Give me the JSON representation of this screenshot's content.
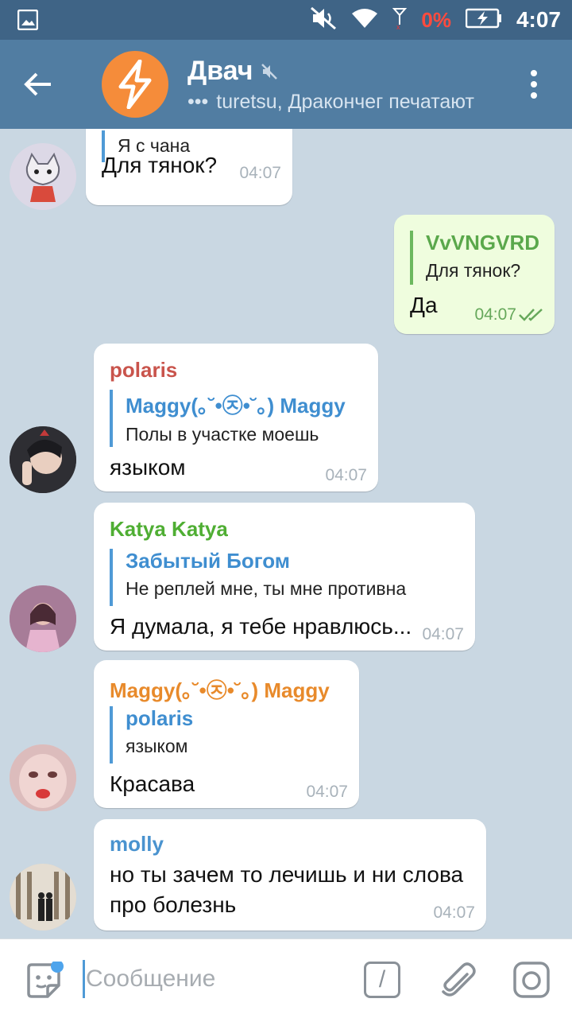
{
  "status": {
    "time": "4:07",
    "battery": "0%"
  },
  "header": {
    "title": "Двач",
    "subtitle": "turetsu, Дракончег печатают",
    "typing_dots": "•••"
  },
  "messages": [
    {
      "reply_text": "Я с чана",
      "text": "Для тянок?",
      "time": "04:07"
    },
    {
      "reply_name": "VvVNGVRD",
      "reply_text": "Для тянок?",
      "text": "Да",
      "time": "04:07"
    },
    {
      "sender": "polaris",
      "sender_color": "#c9544c",
      "reply_name": "Maggy(｡˘•㉨•˘｡) Maggy",
      "reply_text": "Полы в участке моешь",
      "text": "языком",
      "time": "04:07"
    },
    {
      "sender": "Katya Katya",
      "sender_color": "#4fae33",
      "reply_name": "Забытый Богом",
      "reply_text": "Не реплей мне, ты мне противна",
      "text": "Я думала, я тебе нравлюсь...",
      "time": "04:07"
    },
    {
      "sender": "Maggy(｡˘•㉨•˘｡) Maggy",
      "sender_color": "#e88a2b",
      "reply_name": "polaris",
      "reply_text": "языком",
      "text": "Красава",
      "time": "04:07"
    },
    {
      "sender": "molly",
      "sender_color": "#4a93cf",
      "text_line1": "но ты зачем то лечишь и ни слова",
      "text_line2": "про болезнь",
      "time": "04:07"
    }
  ],
  "input": {
    "placeholder": "Сообщение",
    "command": "/"
  },
  "colors": {
    "header": "#517da2",
    "statusbar": "#3f6486",
    "chat_bg": "#c9d7e2",
    "out_bubble": "#effdde",
    "accent": "#4f9ad6"
  }
}
